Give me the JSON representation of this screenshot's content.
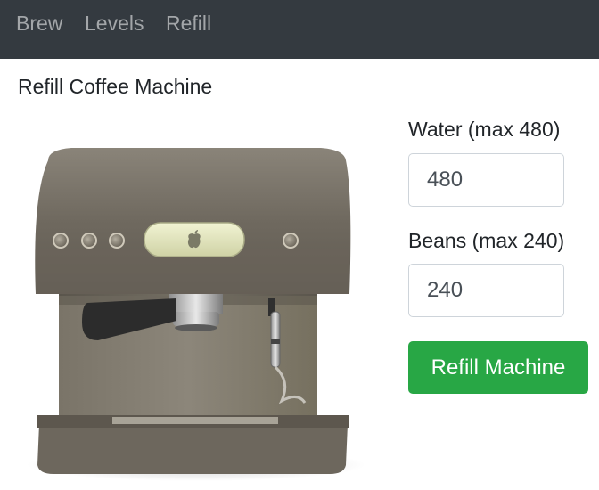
{
  "nav": {
    "items": [
      {
        "label": "Brew"
      },
      {
        "label": "Levels"
      },
      {
        "label": "Refill"
      }
    ]
  },
  "page": {
    "title": "Refill Coffee Machine"
  },
  "form": {
    "water": {
      "label": "Water (max 480)",
      "value": "480"
    },
    "beans": {
      "label": "Beans (max 240)",
      "value": "240"
    },
    "submit_label": "Refill Machine"
  },
  "colors": {
    "navbar": "#343a40",
    "nav_link": "#9a9da0",
    "button": "#28a745",
    "machine_body": "#6e685e"
  },
  "icons": {
    "machine_logo": "apple-logo-icon"
  }
}
